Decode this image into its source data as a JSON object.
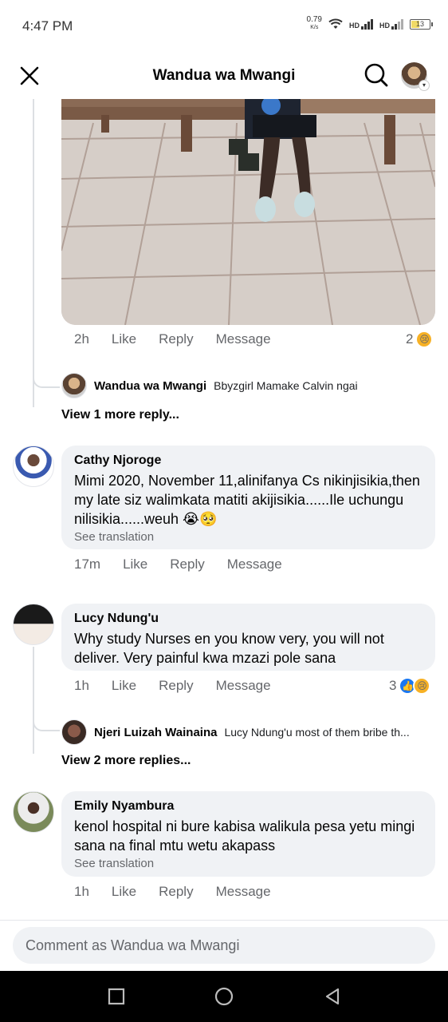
{
  "status_bar": {
    "time": "4:47 PM",
    "net_speed": "0.79",
    "net_unit": "K/s",
    "hd1": "HD",
    "hd2": "HD",
    "battery": "13"
  },
  "header": {
    "title": "Wandua wa Mwangi"
  },
  "post_image": {
    "actions": {
      "time": "2h",
      "like": "Like",
      "reply": "Reply",
      "message": "Message"
    },
    "reaction_count": "2"
  },
  "thread1": {
    "reply": {
      "author": "Wandua wa Mwangi",
      "text": "Bbyzgirl Mamake Calvin ngai"
    },
    "view_more": "View 1 more reply..."
  },
  "comments": [
    {
      "author": "Cathy Njoroge",
      "text": "Mimi 2020, November 11,alinifanya Cs nikinjisikia,then my late siz walimkata matiti akijisikia......Ile uchungu nilisikia......weuh 😭🥺",
      "see_translation": "See translation",
      "time": "17m",
      "like": "Like",
      "reply": "Reply",
      "message": "Message"
    },
    {
      "author": "Lucy Ndung'u",
      "text": "Why study Nurses en you know very, you will not deliver. Very painful kwa mzazi pole sana",
      "time": "1h",
      "like": "Like",
      "reply": "Reply",
      "message": "Message",
      "reaction_count": "3"
    },
    {
      "author": "Emily Nyambura",
      "text": "kenol hospital ni bure kabisa walikula pesa yetu mingi sana na final mtu wetu akapass",
      "see_translation": "See translation",
      "time": "1h",
      "like": "Like",
      "reply": "Reply",
      "message": "Message"
    }
  ],
  "thread2": {
    "reply": {
      "author": "Njeri Luizah Wainaina",
      "text": "Lucy Ndung'u most of them bribe th..."
    },
    "view_more": "View 2 more replies..."
  },
  "composer": {
    "placeholder": "Comment as Wandua wa Mwangi"
  },
  "icons": {
    "close": "close-icon",
    "search": "search-icon",
    "sad_reaction": "sad-reaction-icon",
    "like_reaction": "like-reaction-icon"
  },
  "colors": {
    "bubble": "#f0f2f5",
    "muted_text": "#65676b",
    "like_blue": "#1877f2",
    "sad_yellow": "#f7b125"
  }
}
